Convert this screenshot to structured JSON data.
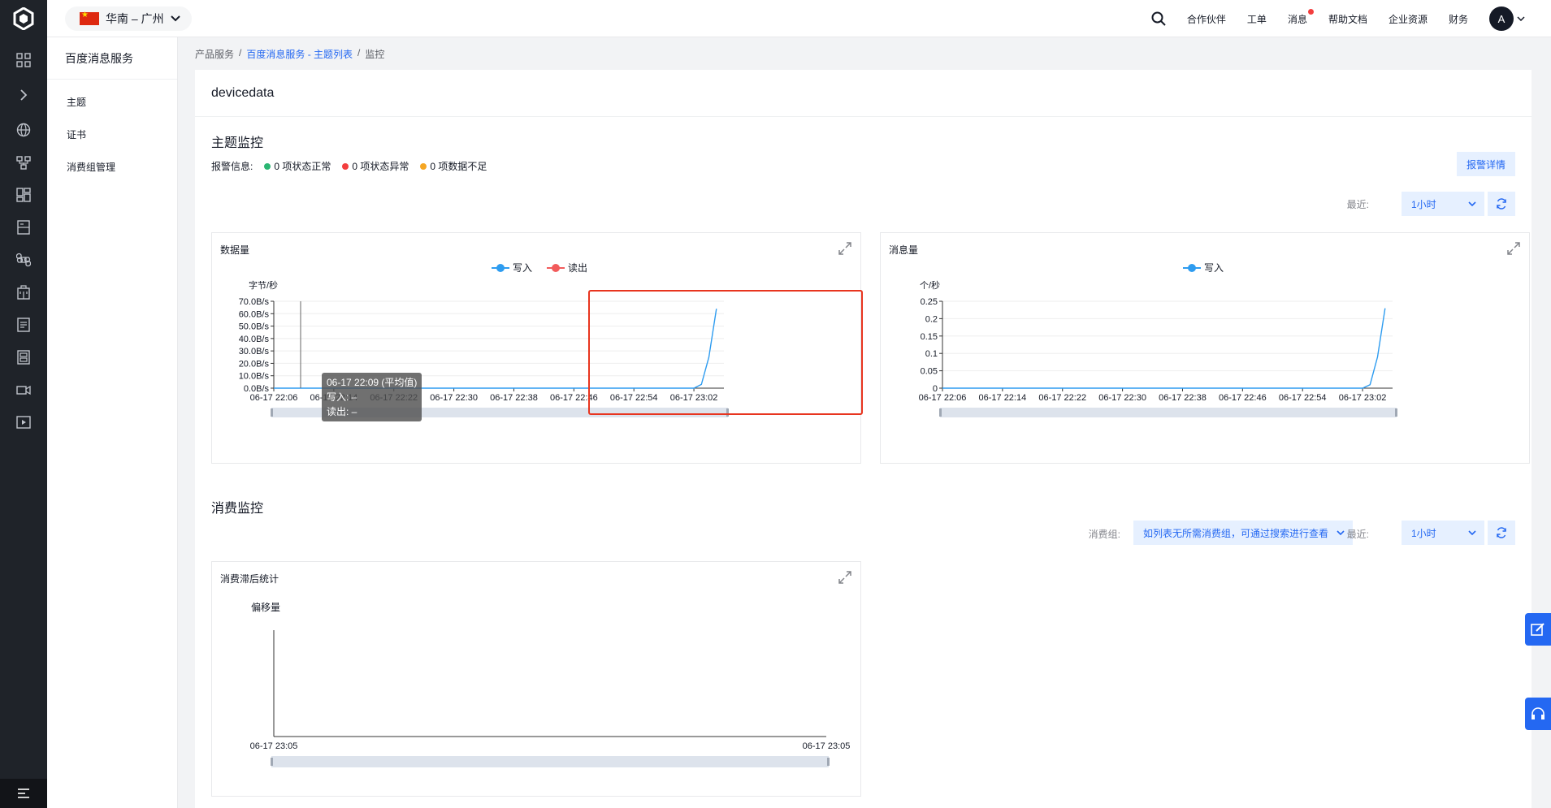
{
  "top": {
    "region": "华南 – 广州",
    "nav": [
      "合作伙伴",
      "工单",
      "消息",
      "帮助文档",
      "企业资源",
      "财务"
    ],
    "avatar": "A"
  },
  "sidebar": {
    "title": "百度消息服务",
    "items": [
      "主题",
      "证书",
      "消费组管理"
    ]
  },
  "breadcrumb": [
    "产品服务",
    "百度消息服务 - 主题列表",
    "监控"
  ],
  "page": {
    "title": "devicedata",
    "topic_section": "主题监控",
    "alarm_label": "报警信息:",
    "alarm_items": [
      "0 项状态正常",
      "0 项状态异常",
      "0 项数据不足"
    ],
    "alarm_colors": [
      "#2bb673",
      "#f33e3e",
      "#f5a623"
    ],
    "alarm_button": "报警详情",
    "recent_label": "最近:",
    "recent_value": "1小时",
    "consume_section": "消费监控",
    "consumer_group_label": "消费组:",
    "consumer_group_placeholder": "如列表无所需消费组，可通过搜索进行查看",
    "recent_value2": "1小时"
  },
  "tooltip": {
    "title": "06-17 22:09 (平均值)",
    "line1": "写入: –",
    "line2": "读出: –"
  },
  "chart_data": [
    {
      "type": "line",
      "title": "数据量",
      "ylabel": "字节/秒",
      "legend": "top-center",
      "grid": true,
      "yticks": [
        "0.0B/s",
        "10.0B/s",
        "20.0B/s",
        "30.0B/s",
        "40.0B/s",
        "50.0B/s",
        "60.0B/s",
        "70.0B/s"
      ],
      "ylim": [
        0,
        70
      ],
      "xticks": [
        "06-17 22:06",
        "06-17 22:14",
        "06-17 22:22",
        "06-17 22:30",
        "06-17 22:38",
        "06-17 22:46",
        "06-17 22:54",
        "06-17 23:02"
      ],
      "series": [
        {
          "name": "写入",
          "color": "#2e9cf0",
          "points": [
            [
              "06-17 22:06",
              0
            ],
            [
              "06-17 23:02",
              0
            ],
            [
              "06-17 23:03",
              3
            ],
            [
              "06-17 23:04",
              25
            ],
            [
              "06-17 23:05",
              64
            ]
          ]
        },
        {
          "name": "读出",
          "color": "#f25b5b",
          "points": []
        }
      ]
    },
    {
      "type": "line",
      "title": "消息量",
      "ylabel": "个/秒",
      "legend": "top-center",
      "grid": true,
      "yticks": [
        "0",
        "0.05",
        "0.1",
        "0.15",
        "0.2",
        "0.25"
      ],
      "ylim": [
        0,
        0.25
      ],
      "xticks": [
        "06-17 22:06",
        "06-17 22:14",
        "06-17 22:22",
        "06-17 22:30",
        "06-17 22:38",
        "06-17 22:46",
        "06-17 22:54",
        "06-17 23:02"
      ],
      "series": [
        {
          "name": "写入",
          "color": "#2e9cf0",
          "points": [
            [
              "06-17 22:06",
              0
            ],
            [
              "06-17 23:02",
              0
            ],
            [
              "06-17 23:03",
              0.01
            ],
            [
              "06-17 23:04",
              0.09
            ],
            [
              "06-17 23:05",
              0.23
            ]
          ]
        }
      ]
    },
    {
      "type": "line",
      "title": "消费滞后统计",
      "ylabel": "偏移量",
      "xticks": [
        "06-17 23:05",
        "06-17 23:05"
      ],
      "series": []
    }
  ]
}
